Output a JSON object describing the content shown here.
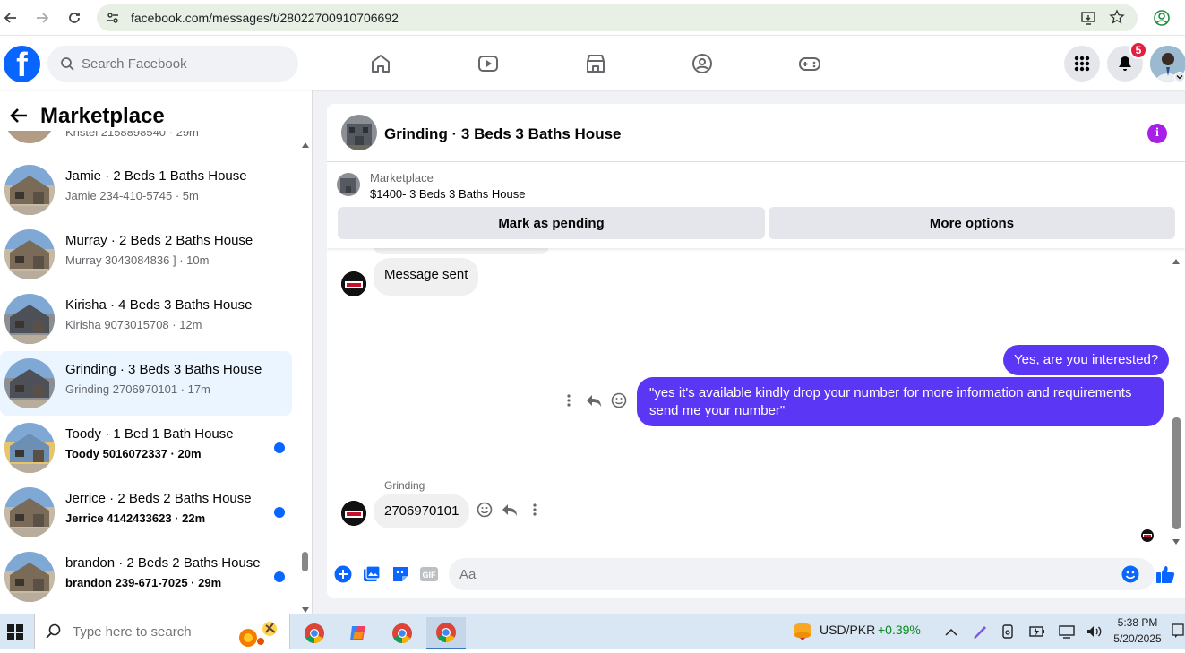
{
  "browser": {
    "url": "facebook.com/messages/t/28022700910706692"
  },
  "nav": {
    "search_placeholder": "Search Facebook",
    "notification_count": "5"
  },
  "sidebar": {
    "title": "Marketplace",
    "partial_top": "Kristel 2158898540 · 29m",
    "conversations": [
      {
        "title": "Jamie · 2 Beds 1 Baths House",
        "sub": "Jamie 234-410-5745 · 5m",
        "unread": false,
        "active": false
      },
      {
        "title": "Murray · 2 Beds 2 Baths House",
        "sub": "Murray 3043084836 ] · 10m",
        "unread": false,
        "active": false
      },
      {
        "title": "Kirisha · 4 Beds 3 Baths House",
        "sub": "Kirisha 9073015708 · 12m",
        "unread": false,
        "active": false
      },
      {
        "title": "Grinding · 3 Beds 3 Baths House",
        "sub": "Grinding 2706970101 · 17m",
        "unread": false,
        "active": true
      },
      {
        "title": "Toody · 1 Bed 1 Bath House",
        "sub": "Toody 5016072337 · 20m",
        "unread": true,
        "active": false
      },
      {
        "title": "Jerrice · 2 Beds 2 Baths House",
        "sub": "Jerrice 4142433623 · 22m",
        "unread": true,
        "active": false
      },
      {
        "title": "brandon · 2 Beds 2 Baths House",
        "sub": "brandon 239-671-7025 · 29m",
        "unread": true,
        "active": false
      }
    ]
  },
  "chat": {
    "title": "Grinding · 3 Beds 3 Baths House",
    "listing_label": "Marketplace",
    "listing_desc": "$1400- 3 Beds 3 Baths House",
    "mark_pending": "Mark as pending",
    "more_options": "More options",
    "messages": {
      "sent_notice": "Message sent",
      "out_1": "Yes, are you interested?",
      "out_2": "\"yes it's available kindly drop your number for more information and requirements send me your number\"",
      "sender_name": "Grinding",
      "in_1": "2706970101"
    },
    "composer_placeholder": "Aa"
  },
  "taskbar": {
    "search_placeholder": "Type here to search",
    "ticker": "USD/PKR",
    "ticker_change": "+0.39%",
    "time": "5:38 PM",
    "date": "5/20/2025"
  },
  "colors": {
    "fb_blue": "#0866ff",
    "outgoing_bubble": "#5b37f5",
    "badge_red": "#e41e3f",
    "ticker_green": "#0a8a1f"
  }
}
